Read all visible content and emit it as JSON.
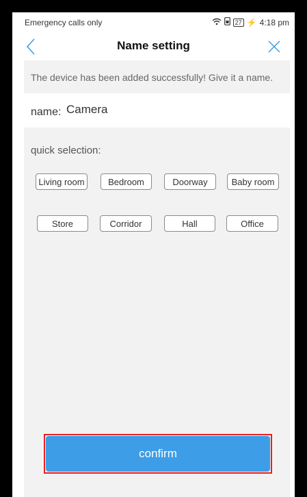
{
  "status_bar": {
    "carrier_text": "Emergency calls only",
    "wifi_icon": "wifi-icon",
    "sim_icon": "sim-icon",
    "battery_level": "27",
    "charging_icon": "charging-icon",
    "time": "4:18 pm"
  },
  "nav": {
    "title": "Name setting",
    "back_icon": "chevron-left-icon",
    "close_icon": "close-icon",
    "accent_color": "#3d9ee7"
  },
  "info_text": "The device has been added successfully! Give it a name.",
  "name_field": {
    "label": "name:",
    "value": "Camera"
  },
  "quick_selection": {
    "label": "quick selection:",
    "options": [
      "Living room",
      "Bedroom",
      "Doorway",
      "Baby room",
      "Store",
      "Corridor",
      "Hall",
      "Office"
    ]
  },
  "confirm": {
    "label": "confirm",
    "button_color": "#3d9ee7",
    "highlight_color": "#e8201f"
  }
}
